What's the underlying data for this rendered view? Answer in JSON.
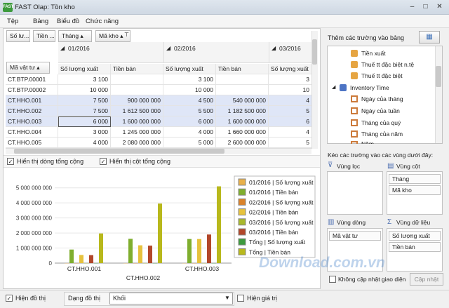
{
  "window": {
    "title": "FAST Olap: Tồn kho",
    "min": "–",
    "max": "□",
    "close": "✕"
  },
  "menu": [
    "Tệp",
    "Bảng",
    "Biểu đồ",
    "Chức năng"
  ],
  "pivot": {
    "filter_fields": [
      "Số lư...",
      "Tiền ..."
    ],
    "column_fields": [
      "Tháng",
      "Mã kho"
    ],
    "row_field": "Mã vật tư",
    "months": [
      "01/2016",
      "02/2016",
      "03/2016"
    ],
    "measure_headers": [
      "Số lượng xuất",
      "Tiền bán",
      "Số lượng xuất",
      "Tiền bán",
      "Số lượng xuất"
    ],
    "rows": [
      {
        "code": "CT.BTP.00001",
        "v": [
          "3 100",
          "",
          "3 100",
          "",
          "3"
        ]
      },
      {
        "code": "CT.BTP.00002",
        "v": [
          "10 000",
          "",
          "10 000",
          "",
          "10"
        ]
      },
      {
        "code": "CT.HHO.001",
        "v": [
          "7 500",
          "900 000 000",
          "4 500",
          "540 000 000",
          "4"
        ]
      },
      {
        "code": "CT.HHO.002",
        "v": [
          "7 500",
          "1 612 500 000",
          "5 500",
          "1 182 500 000",
          "5"
        ]
      },
      {
        "code": "CT.HHO.003",
        "v": [
          "6 000",
          "1 600 000 000",
          "6 000",
          "1 600 000 000",
          "6"
        ]
      },
      {
        "code": "CT.HHO.004",
        "v": [
          "3 000",
          "1 245 000 000",
          "4 000",
          "1 660 000 000",
          "4"
        ]
      },
      {
        "code": "CT.HHO.005",
        "v": [
          "4 000",
          "2 080 000 000",
          "5 000",
          "2 600 000 000",
          "5"
        ]
      }
    ]
  },
  "options": {
    "show_row_totals": "Hiển thị dòng tổng cộng",
    "show_col_totals": "Hiển thị cột tổng cộng"
  },
  "chart_data": {
    "type": "bar",
    "categories": [
      "CT.HHO.001",
      "CT.HHO.002",
      "CT.HHO.003"
    ],
    "ylim": [
      0,
      5500000000
    ],
    "yticks": [
      "0",
      "1 000 000 000",
      "2 000 000 000",
      "3 000 000 000",
      "4 000 000 000",
      "5 000 000 000"
    ],
    "series": [
      {
        "name": "01/2016 | Số lượng xuất",
        "color": "#e8b04a",
        "values": [
          7500,
          7500,
          6000
        ]
      },
      {
        "name": "01/2016 | Tiền bán",
        "color": "#7fae2e",
        "values": [
          900000000,
          1612500000,
          1600000000
        ]
      },
      {
        "name": "02/2016 | Số lượng xuất",
        "color": "#d9822b",
        "values": [
          4500,
          5500,
          6000
        ]
      },
      {
        "name": "02/2016 | Tiền bán",
        "color": "#e6c23d",
        "values": [
          540000000,
          1182500000,
          1600000000
        ]
      },
      {
        "name": "03/2016 | Số lượng xuất",
        "color": "#a8b82c",
        "values": [
          4000,
          5000,
          6000
        ]
      },
      {
        "name": "03/2016 | Tiền bán",
        "color": "#b2472a",
        "values": [
          530000000,
          1160000000,
          1900000000
        ]
      },
      {
        "name": "Tổng | Số lượng xuất",
        "color": "#3e9a3e",
        "values": [
          16000,
          18000,
          18000
        ]
      },
      {
        "name": "Tổng | Tiền bán",
        "color": "#b8b81c",
        "values": [
          1970000000,
          3955000000,
          5100000000
        ]
      }
    ]
  },
  "right_panel": {
    "title": "Thêm các trường vào bảng",
    "tree": [
      "Tiền xuất",
      "Thuế tt đặc biệt n.tệ",
      "Thuế tt đặc biệt",
      "Inventory Time",
      "Ngày của tháng",
      "Ngày của tuần",
      "Tháng của quý",
      "Tháng của năm",
      "Năm"
    ],
    "drag_hint": "Kéo các trường vào các vùng dưới đây:",
    "zones": {
      "filter": "Vùng lọc",
      "column": "Vùng cột",
      "row": "Vùng dòng",
      "data": "Vùng dữ liệu"
    },
    "column_items": [
      "Tháng",
      "Mã kho"
    ],
    "row_items": [
      "Mã vật tư"
    ],
    "data_items": [
      "Số lượng xuất",
      "Tiền bán"
    ],
    "no_update": "Không cập nhật giao diện",
    "update_btn": "Cập nhật"
  },
  "statusbar": {
    "show_chart": "Hiện đồ thị",
    "chart_type_label": "Dạng đồ thị",
    "chart_type_value": "Khối",
    "show_values": "Hiện giá trị"
  },
  "watermark": "Download.com.vn"
}
